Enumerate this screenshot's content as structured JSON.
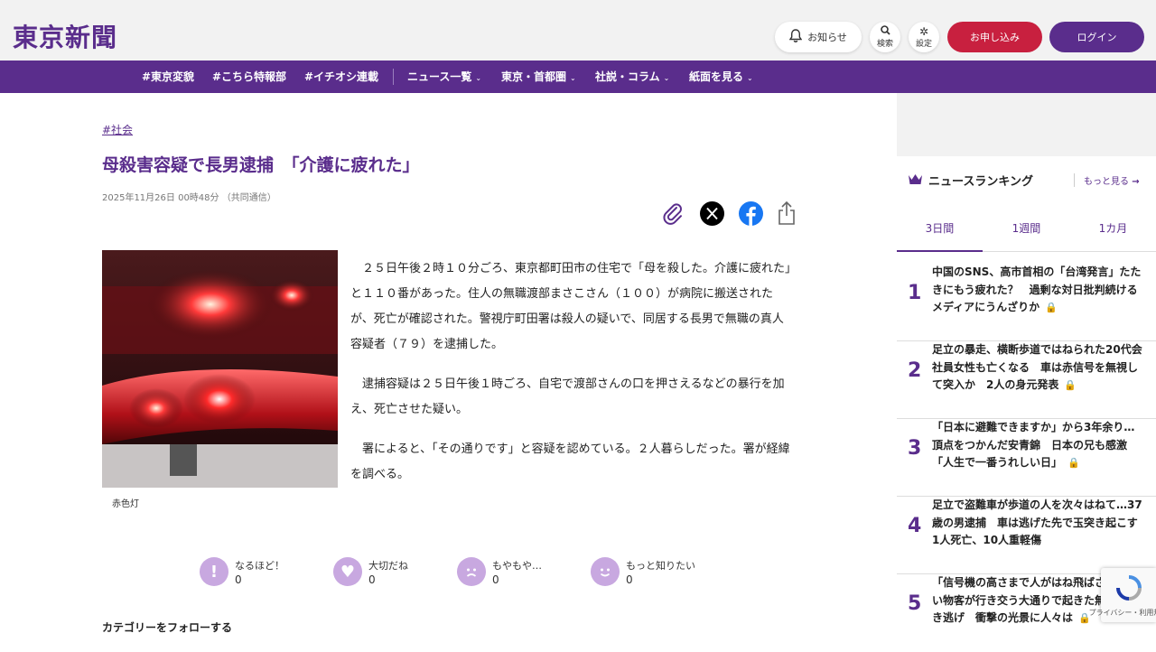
{
  "header": {
    "logo": "東京新聞",
    "notice_label": "お知らせ",
    "search_label": "検索",
    "settings_label": "設定",
    "apply_label": "お申し込み",
    "login_label": "ログイン"
  },
  "nav": {
    "items": [
      {
        "label": "#東京変貌"
      },
      {
        "label": "#こちら特報部"
      },
      {
        "label": "#イチオシ連載"
      },
      {
        "label": "ニュース一覧"
      },
      {
        "label": "東京・首都圏"
      },
      {
        "label": "社説・コラム"
      },
      {
        "label": "紙面を見る"
      }
    ]
  },
  "article": {
    "tag": "#社会",
    "title": "母殺害容疑で長男逮捕　「介護に疲れた」",
    "date": "2025年11月26日 00時48分 （共同通信）",
    "caption": "赤色灯",
    "paragraphs": [
      "２５日午後２時１０分ごろ、東京都町田市の住宅で「母を殺した。介護に疲れた」と１１０番があった。住人の無職渡部まさこさん（１００）が病院に搬送されたが、死亡が確認された。警視庁町田署は殺人の疑いで、同居する長男で無職の真人容疑者（７９）を逮捕した。",
      "逮捕容疑は２５日午後１時ごろ、自宅で渡部さんの口を押さえるなどの暴行を加え、死亡させた疑い。",
      "署によると、「その通りです」と容疑を認めている。２人暮らしだった。署が経緯を調べる。"
    ]
  },
  "reactions": [
    {
      "label": "なるほど！",
      "count": "0"
    },
    {
      "label": "大切だね",
      "count": "0"
    },
    {
      "label": "もやもや…",
      "count": "0"
    },
    {
      "label": "もっと知りたい",
      "count": "0"
    }
  ],
  "follow_label": "カテゴリーをフォローする",
  "sidebar": {
    "ranking_title": "ニュースランキング",
    "more_label": "もっと見る",
    "tabs": [
      {
        "label": "3日間"
      },
      {
        "label": "1週間"
      },
      {
        "label": "1カ月"
      }
    ],
    "items": [
      {
        "rank": "1",
        "text": "中国のSNS、高市首相の「台湾発言」たたきにもう疲れた？　過剰な対日批判続けるメディアにうんざりか",
        "lock": "gold"
      },
      {
        "rank": "2",
        "text": "足立の暴走、横断歩道ではねられた20代会社員女性も亡くなる　車は赤信号を無視して突入か　2人の身元発表",
        "lock": "gray"
      },
      {
        "rank": "3",
        "text": "「日本に避難できますか」から3年余り…頂点をつかんだ安青錦　日本の兄も感激「人生で一番うれしい日」",
        "lock": "gold"
      },
      {
        "rank": "4",
        "text": "足立で盗難車が歩道の人を次々はねて…37歳の男逮捕　車は逃げた先で玉突き起こす　1人死亡、10人重軽傷",
        "lock": ""
      },
      {
        "rank": "5",
        "text": "「信号機の高さまで人がはね飛ばされた」い物客が行き交う大通りで起きた無差別ひき逃げ　衝撃の光景に人々は",
        "lock": "gray"
      }
    ]
  },
  "recaptcha": {
    "label": "プライバシー・利用規約"
  },
  "colors": {
    "brand": "#5a2d8c",
    "apply": "#c8203f",
    "reaction": "#c8a8e0"
  }
}
